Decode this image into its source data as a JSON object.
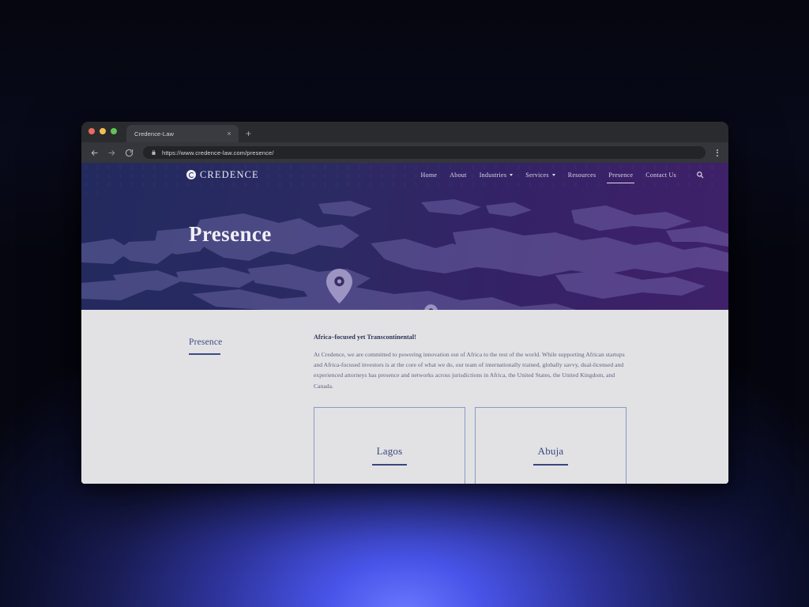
{
  "browser": {
    "window_controls": [
      "close",
      "minimize",
      "maximize"
    ],
    "tab_title": "Credence-Law",
    "tab_close_glyph": "×",
    "new_tab_glyph": "+",
    "url": "https://www.credence-law.com/presence/",
    "back_icon": "back-arrow-icon",
    "forward_icon": "forward-arrow-icon",
    "reload_icon": "reload-icon",
    "lock_icon": "lock-icon",
    "menu_icon": "three-dot-menu-icon"
  },
  "site": {
    "logo_text": "CREDENCE",
    "nav": [
      {
        "label": "Home",
        "has_dropdown": false,
        "active": false
      },
      {
        "label": "About",
        "has_dropdown": false,
        "active": false
      },
      {
        "label": "Industries",
        "has_dropdown": true,
        "active": false
      },
      {
        "label": "Services",
        "has_dropdown": true,
        "active": false
      },
      {
        "label": "Resources",
        "has_dropdown": false,
        "active": false
      },
      {
        "label": "Presence",
        "has_dropdown": false,
        "active": true
      },
      {
        "label": "Contact Us",
        "has_dropdown": false,
        "active": false
      }
    ],
    "search_icon": "search-icon"
  },
  "hero": {
    "title": "Presence",
    "pins": [
      "map-pin-icon",
      "map-pin-icon",
      "map-pin-icon"
    ],
    "gradient_from": "#232a5e",
    "gradient_to": "#3e2169"
  },
  "content": {
    "aside_title": "Presence",
    "heading": "Africa–focused yet Transcontinental!",
    "paragraph": "At Credence, we are committed to powering innovation out of Africa to the rest of the world. While supporting African startups and Africa-focused investors is at the core of what we do, our team of internationally trained, globally savvy, dual-licensed and experienced attorneys has presence and networks across jurisdictions in Africa, the United States, the United Kingdom, and Canada.",
    "locations": [
      {
        "name": "Lagos"
      },
      {
        "name": "Abuja"
      }
    ],
    "background": "#e2e2e4",
    "accent": "#39477f"
  }
}
